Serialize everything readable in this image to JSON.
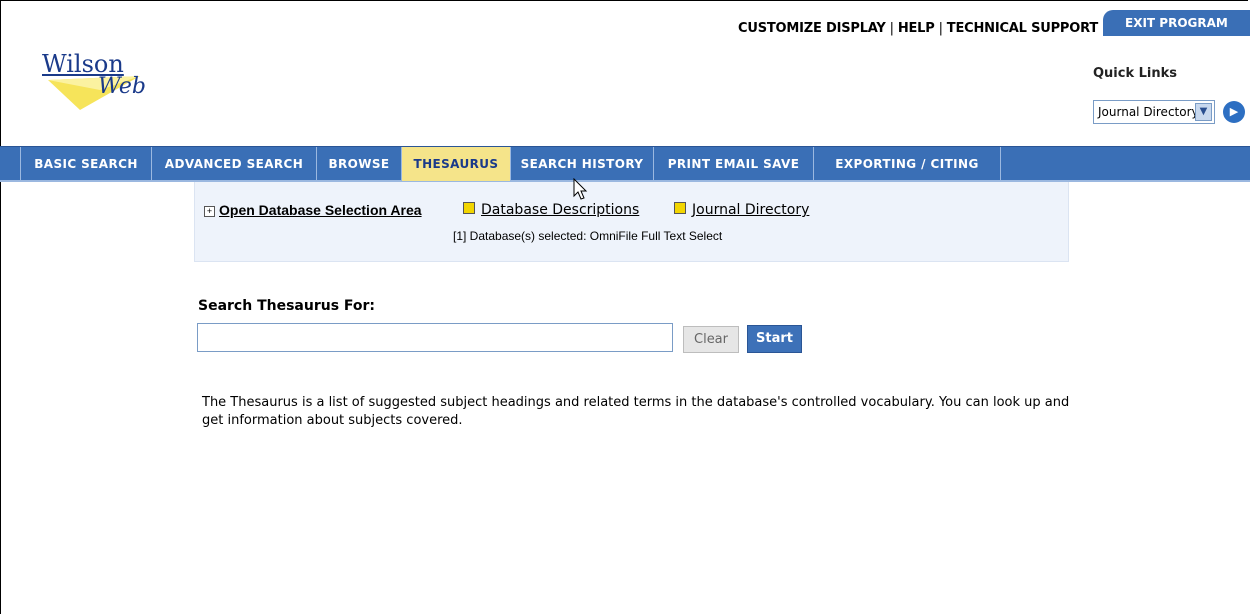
{
  "logo": {
    "word1": "Wilson",
    "word2": "Web"
  },
  "top_links": {
    "customize": "CUSTOMIZE DISPLAY",
    "help": "HELP",
    "support": "TECHNICAL SUPPORT",
    "separator": "|"
  },
  "exit_label": "EXIT PROGRAM",
  "quick_links": {
    "label": "Quick Links",
    "selected": "Journal Directory"
  },
  "nav": [
    {
      "label": "BASIC SEARCH",
      "active": false
    },
    {
      "label": "ADVANCED SEARCH",
      "active": false
    },
    {
      "label": "BROWSE",
      "active": false
    },
    {
      "label": "THESAURUS",
      "active": true
    },
    {
      "label": "SEARCH HISTORY",
      "active": false
    },
    {
      "label": "PRINT EMAIL SAVE",
      "active": false
    },
    {
      "label": "EXPORTING / CITING",
      "active": false
    }
  ],
  "db_panel": {
    "toggle_symbol": "+",
    "open_label": "Open Database Selection Area",
    "db_descriptions": "Database Descriptions",
    "journal_directory": "Journal Directory",
    "selected_text": "[1] Database(s) selected: OmniFile Full Text Select"
  },
  "search": {
    "label": "Search Thesaurus For:",
    "value": "",
    "clear_label": "Clear",
    "start_label": "Start"
  },
  "description": "The Thesaurus is a list of suggested subject headings and related terms in the database's controlled vocabulary. You can look up and get information about subjects covered.",
  "colors": {
    "nav_bg": "#3a6fb6",
    "active_tab": "#f5e48a",
    "panel_bg": "#eef3fb",
    "accent_yellow": "#f2d500"
  }
}
